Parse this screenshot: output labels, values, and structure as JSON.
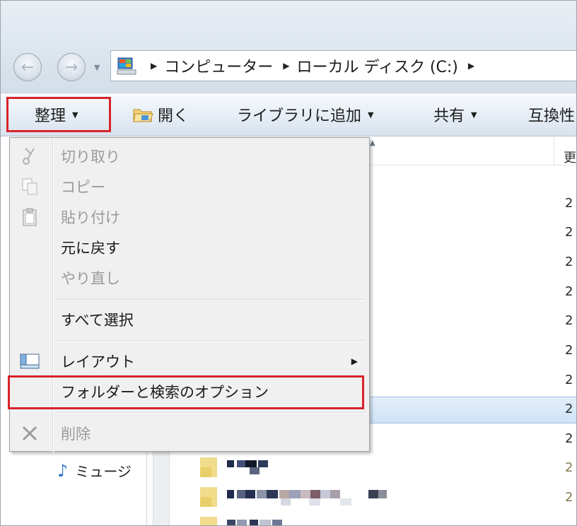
{
  "address": {
    "crumbs": [
      "コンピューター",
      "ローカル ディスク (C:)"
    ]
  },
  "toolbar": {
    "organize": "整理",
    "open": "開く",
    "add_to_library": "ライブラリに追加",
    "share": "共有",
    "compat": "互換性"
  },
  "menu": {
    "cut": "切り取り",
    "copy": "コピー",
    "paste": "貼り付け",
    "undo": "元に戻す",
    "redo": "やり直し",
    "select_all": "すべて選択",
    "layout": "レイアウト",
    "folder_options": "フォルダーと検索のオプション",
    "delete": "削除"
  },
  "file_list": {
    "column_header": "更",
    "dates": [
      "2",
      "2",
      "2",
      "2",
      "2",
      "2",
      "2",
      "2",
      "2",
      "2",
      "2"
    ],
    "date_partial": [
      "2",
      "2"
    ]
  },
  "nav_pane": {
    "music": "ミュージ"
  },
  "colors": {
    "highlight_box": "#d8232a",
    "selection": "#cfe3f7"
  }
}
